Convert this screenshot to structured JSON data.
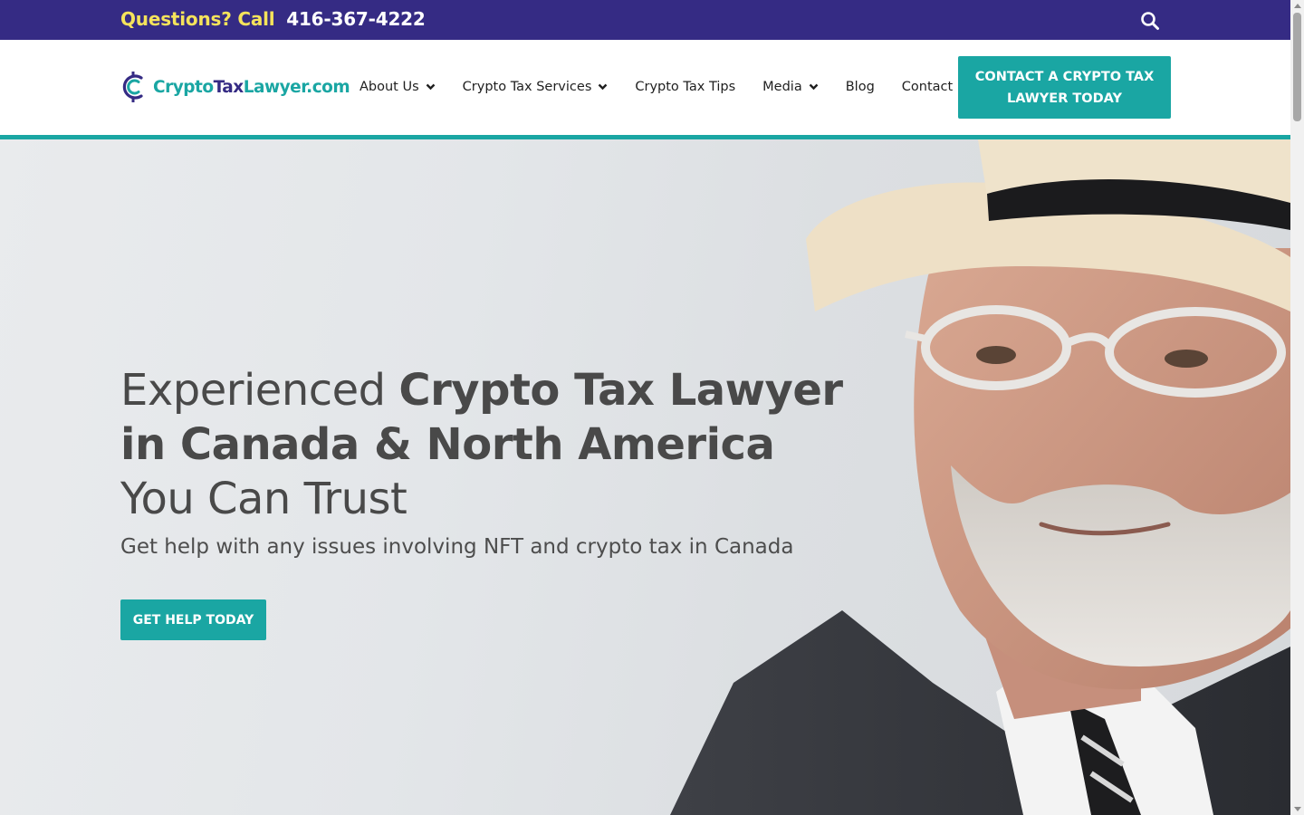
{
  "topbar": {
    "lead": "Questions? Call",
    "phone": "416-367-4222",
    "search_icon": "search-icon",
    "bg_color": "#352b84",
    "lead_color": "#f5e35b"
  },
  "header": {
    "logo": {
      "part1": "Crypto",
      "part2": "Tax",
      "part3": "Lawyer.com"
    },
    "nav": [
      {
        "label": "About Us",
        "has_dropdown": true
      },
      {
        "label": "Crypto Tax Services",
        "has_dropdown": true
      },
      {
        "label": "Crypto Tax Tips",
        "has_dropdown": false
      },
      {
        "label": "Media",
        "has_dropdown": true
      },
      {
        "label": "Blog",
        "has_dropdown": false
      },
      {
        "label": "Contact",
        "has_dropdown": false
      }
    ],
    "cta": "CONTACT A CRYPTO TAX LAWYER TODAY",
    "accent_color": "#1aa6a3"
  },
  "hero": {
    "headline_light_1": "Experienced ",
    "headline_bold": "Crypto Tax Lawyer in Canada & North America",
    "headline_light_2": "You Can Trust",
    "subline": "Get help with any issues involving NFT and crypto tax in Canada",
    "cta": "GET HELP TODAY"
  }
}
